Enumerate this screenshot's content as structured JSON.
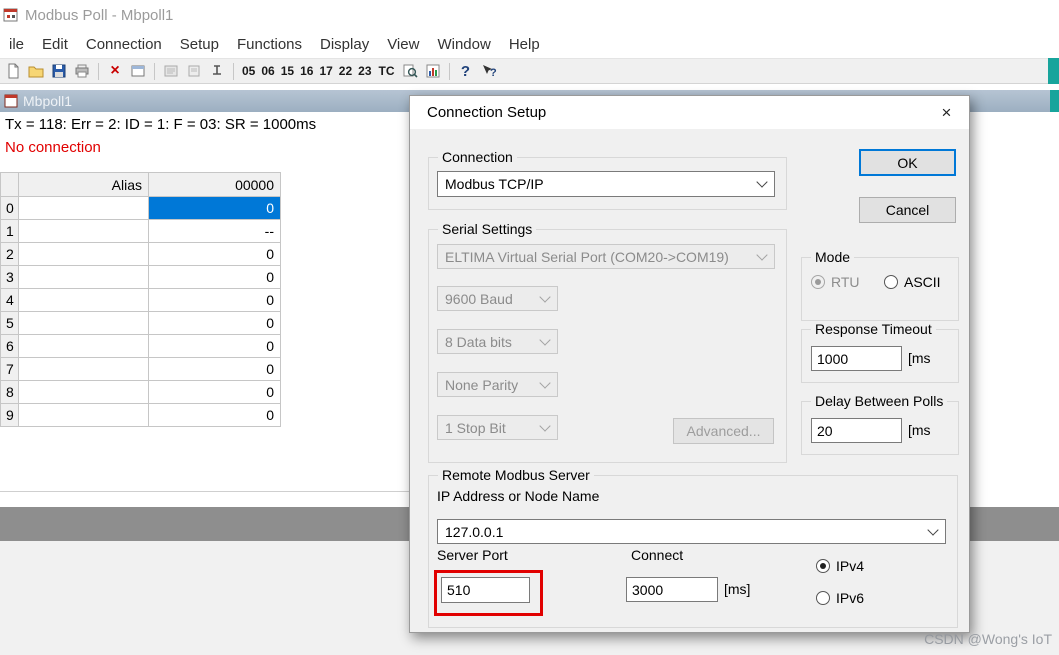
{
  "colors": {
    "accent": "#0078d7",
    "red": "#e10000",
    "teal": "#18a49c"
  },
  "app": {
    "title": "Modbus Poll - Mbpoll1",
    "menu": [
      "ile",
      "Edit",
      "Connection",
      "Setup",
      "Functions",
      "Display",
      "View",
      "Window",
      "Help"
    ],
    "toolbar_numbers": [
      "05",
      "06",
      "15",
      "16",
      "17",
      "22",
      "23"
    ],
    "toolbar_tc": "TC",
    "watermark": "CSDN @Wong's IoT"
  },
  "doc": {
    "title": "Mbpoll1",
    "status_line": "Tx = 118: Err = 2: ID = 1: F = 03: SR = 1000ms",
    "connection_status": "No connection",
    "grid": {
      "col_headers": [
        "",
        "Alias",
        "00000"
      ],
      "rows": [
        {
          "n": "0",
          "alias": "",
          "value": "0",
          "selected": true
        },
        {
          "n": "1",
          "alias": "",
          "value": "--",
          "selected": false
        },
        {
          "n": "2",
          "alias": "",
          "value": "0",
          "selected": false
        },
        {
          "n": "3",
          "alias": "",
          "value": "0",
          "selected": false
        },
        {
          "n": "4",
          "alias": "",
          "value": "0",
          "selected": false
        },
        {
          "n": "5",
          "alias": "",
          "value": "0",
          "selected": false
        },
        {
          "n": "6",
          "alias": "",
          "value": "0",
          "selected": false
        },
        {
          "n": "7",
          "alias": "",
          "value": "0",
          "selected": false
        },
        {
          "n": "8",
          "alias": "",
          "value": "0",
          "selected": false
        },
        {
          "n": "9",
          "alias": "",
          "value": "0",
          "selected": false
        }
      ]
    }
  },
  "dialog": {
    "title": "Connection Setup",
    "ok": "OK",
    "cancel": "Cancel",
    "close": "×",
    "connection": {
      "label": "Connection",
      "value": "Modbus TCP/IP"
    },
    "serial": {
      "label": "Serial Settings",
      "port": "ELTIMA Virtual Serial Port (COM20->COM19)",
      "baud": "9600 Baud",
      "databits": "8 Data bits",
      "parity": "None Parity",
      "stopbits": "1 Stop Bit",
      "advanced": "Advanced..."
    },
    "mode": {
      "label": "Mode",
      "rtu": "RTU",
      "ascii": "ASCII"
    },
    "response_timeout": {
      "label": "Response Timeout",
      "value": "1000",
      "unit": "[ms"
    },
    "delay": {
      "label": "Delay Between Polls",
      "value": "20",
      "unit": "[ms"
    },
    "remote": {
      "label": "Remote Modbus Server",
      "ip_label": "IP Address or Node Name",
      "ip": "127.0.0.1",
      "port_label": "Server Port",
      "port": "510",
      "connect_label": "Connect",
      "connect_timeout": "3000",
      "connect_unit": "[ms]",
      "ipv4": "IPv4",
      "ipv6": "IPv6"
    }
  }
}
